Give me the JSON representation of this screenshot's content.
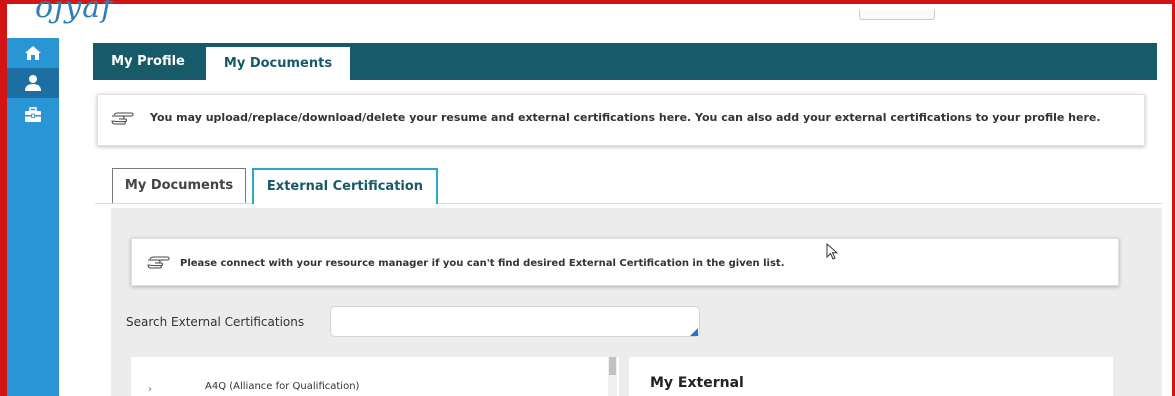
{
  "app": {
    "logo_text": "ojyaf"
  },
  "sidebar": {
    "icons": [
      {
        "name": "home-icon"
      },
      {
        "name": "user-icon"
      },
      {
        "name": "briefcase-icon"
      }
    ]
  },
  "header_tabs": [
    {
      "label": "My Profile",
      "active": false
    },
    {
      "label": "My Documents",
      "active": true
    }
  ],
  "main_notice": {
    "icon": "pointing-hand-icon",
    "text": "You may upload/replace/download/delete your resume and external certifications here.  You can also add your external certifications to your profile here."
  },
  "sub_tabs": [
    {
      "label": "My Documents",
      "active": false
    },
    {
      "label": "External Certification",
      "active": true
    }
  ],
  "certification_notice": {
    "icon": "pointing-hand-icon",
    "text": "Please connect with your resource manager if you can't find desired External Certification in the given list."
  },
  "search": {
    "label": "Search External Certifications",
    "value": ""
  },
  "certification_list": [
    {
      "label": "A4Q (Alliance for Qualification)",
      "expanded": false
    }
  ],
  "my_external": {
    "title": "My External"
  },
  "colors": {
    "sidebar": "#2a95d4",
    "tabbar": "#175a6a",
    "active_subtab_border": "#2aa9c6",
    "frame": "#d21414"
  }
}
